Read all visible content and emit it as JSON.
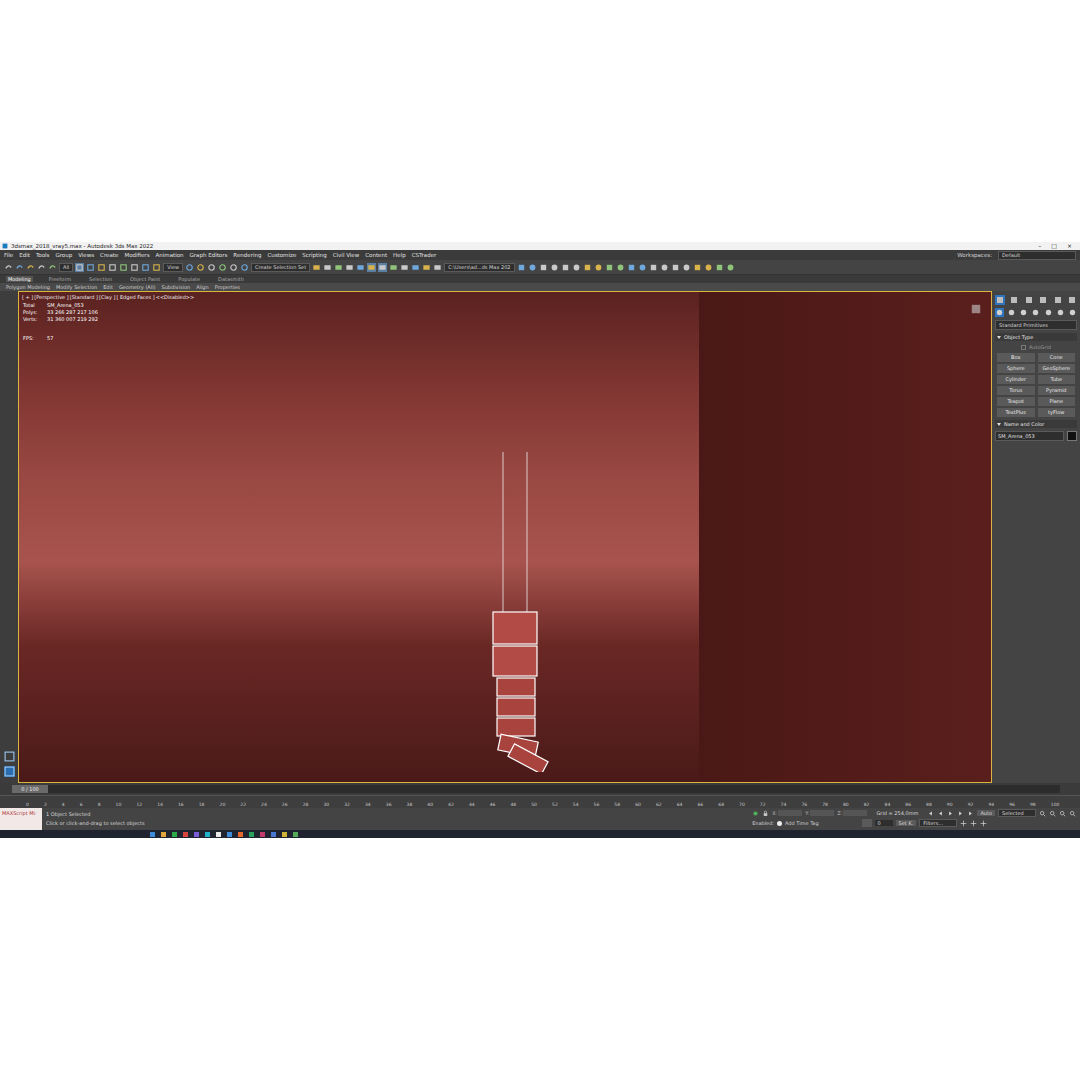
{
  "window": {
    "title": "3dsmax_2018_vray5.max - Autodesk 3ds Max 2022",
    "controls": [
      "–",
      "□",
      "×"
    ]
  },
  "menu": [
    "File",
    "Edit",
    "Tools",
    "Group",
    "Views",
    "Create",
    "Modifiers",
    "Animation",
    "Graph Editors",
    "Rendering",
    "Customize",
    "Scripting",
    "Civil View",
    "Content",
    "Help",
    "CSTrader"
  ],
  "workspaces": {
    "label": "Workspaces:",
    "value": "Default"
  },
  "toolbar": {
    "selection_filter": "All",
    "reference_coord": "View",
    "named_selection": "Create Selection Set",
    "project_path": "C:\\Users\\ad...ds Max 202"
  },
  "ribbon": {
    "tabs": [
      {
        "label": "Modeling",
        "selected": true
      },
      {
        "label": "Freeform",
        "selected": false
      },
      {
        "label": "Selection",
        "selected": false
      },
      {
        "label": "Object Paint",
        "selected": false
      },
      {
        "label": "Populate",
        "selected": false
      },
      {
        "label": "Datasmith",
        "selected": false
      }
    ],
    "groups": [
      "Polygon Modeling",
      "Modify Selection",
      "Edit",
      "Geometry (All)",
      "Subdivision",
      "Align",
      "Properties"
    ]
  },
  "viewport": {
    "labels": [
      "[ + ]",
      "[Perspective ]",
      "[Standard ]",
      "[Clay ]",
      "[ Edged Faces ]"
    ],
    "disabled_note": "<<Disabled>>",
    "stats_total": {
      "label": "Total",
      "value": "SM_Arena_053"
    },
    "stats": [
      {
        "label": "Polys:",
        "value": "33 266 287 217 106"
      },
      {
        "label": "Verts:",
        "value": "31 360 007 219 292"
      }
    ],
    "fps": {
      "label": "FPS:",
      "value": "57"
    }
  },
  "command_panel": {
    "tabs": [
      {
        "selected": true
      },
      {
        "selected": false
      },
      {
        "selected": false
      },
      {
        "selected": false
      },
      {
        "selected": false
      },
      {
        "selected": false
      }
    ],
    "categories": [
      {
        "selected": true
      },
      {
        "selected": false
      },
      {
        "selected": false
      },
      {
        "selected": false
      },
      {
        "selected": false
      },
      {
        "selected": false
      },
      {
        "selected": false
      }
    ],
    "category": "Standard Primitives",
    "object_type": {
      "title": "Object Type",
      "autogrid": {
        "label": "AutoGrid",
        "checked": false
      },
      "buttons": [
        "Box",
        "Cone",
        "Sphere",
        "GeoSphere",
        "Cylinder",
        "Tube",
        "Torus",
        "Pyramid",
        "Teapot",
        "Plane",
        "TextPlus",
        "tyFlow"
      ]
    },
    "name_and_color": {
      "title": "Name and Color",
      "name": "SM_Arena_053",
      "color": "#111111"
    }
  },
  "time_slider": {
    "label": "0 / 100",
    "level": 0
  },
  "track_ticks": [
    "0",
    "2",
    "4",
    "6",
    "8",
    "10",
    "12",
    "14",
    "16",
    "18",
    "20",
    "22",
    "24",
    "26",
    "28",
    "30",
    "32",
    "34",
    "36",
    "38",
    "40",
    "42",
    "44",
    "46",
    "48",
    "50",
    "52",
    "54",
    "56",
    "58",
    "60",
    "62",
    "64",
    "66",
    "68",
    "70",
    "72",
    "74",
    "76",
    "78",
    "80",
    "82",
    "84",
    "86",
    "88",
    "90",
    "92",
    "94",
    "96",
    "98",
    "100"
  ],
  "status": {
    "script_label": "MAXScript Mi:",
    "selection": "1 Object Selected",
    "prompt": "Click or click-and-drag to select objects",
    "coords": [
      "X:",
      "Y:",
      "Z:"
    ],
    "grid": "Grid = 254,0mm",
    "enabled": "Enabled:",
    "time_tag": "Add Time Tag",
    "key_mode": "Auto",
    "key_filter": "Selected",
    "set_key": "Set K.",
    "filters": "Filters...",
    "frame": "0"
  }
}
